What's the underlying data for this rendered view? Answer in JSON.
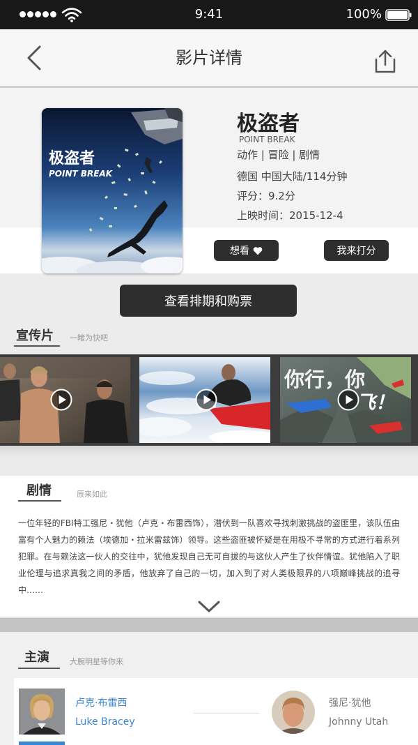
{
  "status_bar": {
    "time": "9:41",
    "battery_percent": "100%",
    "signal_icon": "signal-strength-icon",
    "wifi_icon": "wifi-icon",
    "battery_icon": "battery-icon"
  },
  "nav": {
    "title": "影片详情",
    "back_icon": "chevron-left-icon",
    "share_icon": "share-icon"
  },
  "movie": {
    "title": "极盗者",
    "english_title": "POINT BREAK",
    "genres": "动作 | 冒险 | 剧情",
    "region_duration": "德国 中国大陆/114分钟",
    "rating": "评分：9.2分",
    "release_date": "上映时间：2015-12-4",
    "poster": {
      "title": "极盗者",
      "subtitle": "POINT BREAK"
    }
  },
  "actions": {
    "want_label": "想看",
    "want_icon": "heart-icon",
    "rate_label": "我来打分",
    "tickets_label": "查看排期和购票"
  },
  "trailers": {
    "heading": "宣传片",
    "subheading": "一睹为快吧",
    "items": [
      {
        "play_icon": "play-icon"
      },
      {
        "play_icon": "play-icon"
      },
      {
        "play_icon": "play-icon",
        "caption_line1": "你行，你",
        "caption_line2": "飞！"
      }
    ]
  },
  "plot": {
    "heading": "剧情",
    "subheading": "原来如此",
    "text": "一位年轻的FBI特工强尼・犹他（卢克・布雷西饰），潜伏到一队喜欢寻找刺激挑战的盗匪里，该队伍由富有个人魅力的赖法（埃德加・拉米雷兹饰）领导。这些盗匪被怀疑是在用极不寻常的方式进行着系列犯罪。在与赖法这一伙人的交往中，犹他发现自己无可自拔的与这伙人产生了伙伴情谊。犹他陷入了职业伦理与追求真我之间的矛盾，他放弃了自己的一切，加入到了对人类极限界的八项巅峰挑战的追寻中……",
    "expand_icon": "chevron-down-icon"
  },
  "cast": {
    "heading": "主演",
    "subheading": "大腕明星等你来",
    "members": [
      {
        "actor_cn": "卢克·布雷西",
        "actor_en": "Luke Bracey",
        "role_cn": "强尼·犹他",
        "role_en": "Johnny Utah"
      }
    ]
  },
  "theme": {
    "status_bar_bg": "#181818",
    "dark_button": "#2e2e2e",
    "actor_name_blue": "#3a86d6",
    "page_bg": "#efefef"
  }
}
